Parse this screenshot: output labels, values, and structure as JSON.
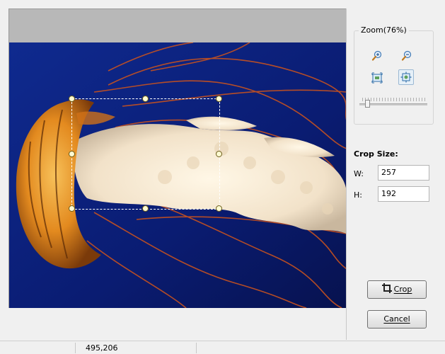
{
  "zoom": {
    "title": "Zoom(76%)",
    "level_percent": 76,
    "buttons": [
      {
        "name": "zoom-in-icon"
      },
      {
        "name": "zoom-out-icon"
      },
      {
        "name": "actual-size-icon"
      },
      {
        "name": "fit-to-window-icon"
      }
    ],
    "active_button": "fit-to-window-icon"
  },
  "crop_size": {
    "title": "Crop Size:",
    "width_label": "W:",
    "width_value": "257",
    "height_label": "H:",
    "height_value": "192"
  },
  "buttons": {
    "crop_label": "Crop",
    "cancel_label": "Cancel"
  },
  "status": {
    "coordinates": "495,206"
  },
  "colors": {
    "background": "#f0f0f0",
    "canvas_gray": "#b8b8b8",
    "sky_top": "#0a1c6e",
    "sky_bottom": "#061045",
    "jellyfish_orange": "#e08a1e",
    "handle_fill": "#fffbd2"
  }
}
